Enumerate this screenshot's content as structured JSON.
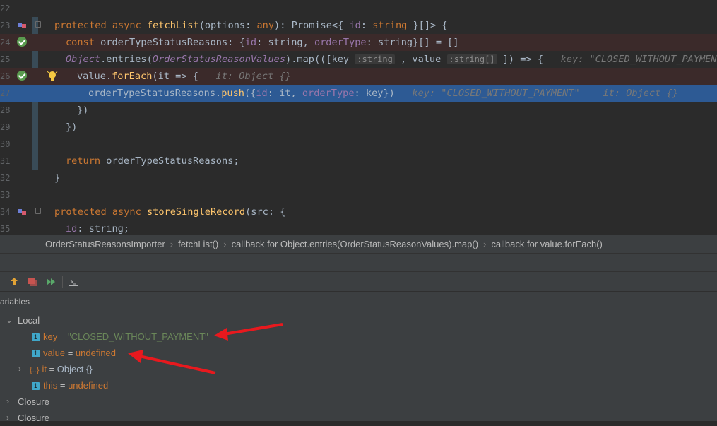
{
  "editor": {
    "lines": [
      {
        "num": "22"
      },
      {
        "num": "23"
      },
      {
        "num": "24"
      },
      {
        "num": "25"
      },
      {
        "num": "26"
      },
      {
        "num": "27"
      },
      {
        "num": "28"
      },
      {
        "num": "29"
      },
      {
        "num": "30"
      },
      {
        "num": "31"
      },
      {
        "num": "32"
      },
      {
        "num": "33"
      },
      {
        "num": "34"
      },
      {
        "num": "35"
      }
    ],
    "code": {
      "l23": {
        "kw1": "protected",
        "kw2": "async",
        "fn": "fetchList",
        "rest1": "(options: ",
        "kw3": "any",
        "rest2": "): Promise<{ ",
        "prop": "id",
        "rest3": ": ",
        "ty": "string",
        "rest4": " }[]> {"
      },
      "l24": {
        "kw": "const",
        "name": " orderTypeStatusReasons: {",
        "p1": "id",
        "t1": ": string, ",
        "p2": "orderType",
        "t2": ": string}[] = []"
      },
      "l25": {
        "obj": "Object",
        "m": ".entries(",
        "cls": "OrderStatusReasonValues",
        "rest": ").map(([key",
        "hint1": ":string",
        "sep": " , value",
        "hint2": ":string[]",
        "end": " ]) => {",
        "inline": "key: \"CLOSED_WITHOUT_PAYMENT\""
      },
      "l26": {
        "v": "value.",
        "fn": "forEach",
        "rest": "(it => {",
        "inline": "it: Object {}"
      },
      "l27": {
        "v": "orderTypeStatusReasons.",
        "fn": "push",
        "rest1": "({",
        "p1": "id",
        "mid": ": it, ",
        "p2": "orderType",
        "end": ": key})",
        "inline1": "key: \"CLOSED_WITHOUT_PAYMENT\"",
        "inline2": "it: Object {}"
      },
      "l28": {
        "text": "})"
      },
      "l29": {
        "text": "})"
      },
      "l31": {
        "kw": "return",
        "rest": " orderTypeStatusReasons;"
      },
      "l32": {
        "text": "}"
      },
      "l34": {
        "kw1": "protected",
        "kw2": "async",
        "fn": "storeSingleRecord",
        "rest": "(src: {"
      },
      "l35": {
        "p": "id",
        "rest": ": string;"
      }
    }
  },
  "breadcrumb": [
    "OrderStatusReasonsImporter",
    "fetchList()",
    "callback for Object.entries(OrderStatusReasonValues).map()",
    "callback for value.forEach()"
  ],
  "panel": {
    "label": "ariables",
    "local": "Local",
    "vars": [
      {
        "name": "key",
        "eq": " = ",
        "value": "\"CLOSED_WITHOUT_PAYMENT\""
      },
      {
        "name": "value",
        "eq": " = ",
        "value": "undefined"
      },
      {
        "name": "it",
        "eq": " = ",
        "value": "Object {}"
      },
      {
        "name": "this",
        "eq": " = ",
        "value": "undefined"
      }
    ],
    "closures": [
      "Closure",
      "Closure"
    ]
  },
  "colors": {
    "accent_red": "#e8191e",
    "selection": "#2d5a94"
  }
}
